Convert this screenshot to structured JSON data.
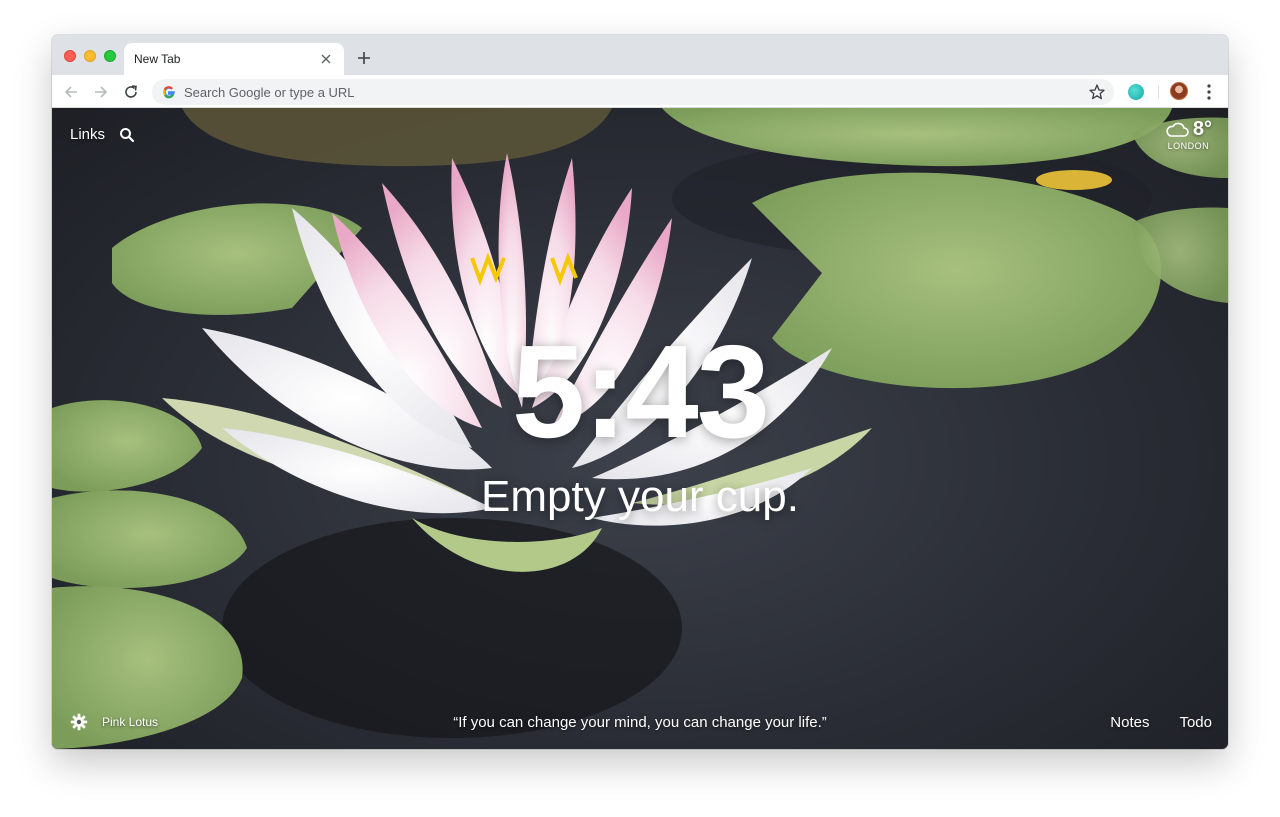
{
  "browser": {
    "tab": {
      "title": "New Tab",
      "close_icon": "close-icon"
    },
    "new_tab_icon": "plus-icon",
    "omnibox": {
      "placeholder": "Search Google or type a URL",
      "icon": "google-icon"
    },
    "toolbar_icons": [
      "back-icon",
      "forward-icon",
      "reload-icon",
      "star-icon",
      "extension-icon",
      "profile-avatar",
      "menu-icon"
    ]
  },
  "dashboard": {
    "links_label": "Links",
    "weather": {
      "temperature": "8°",
      "location": "LONDON",
      "icon": "cloud-icon"
    },
    "clock": "5:43",
    "mantra": "Empty your cup.",
    "photo_credit": "Pink Lotus",
    "quote": "“If you can change your mind, you can change your life.”",
    "notes_label": "Notes",
    "todo_label": "Todo"
  },
  "colors": {
    "accent_text": "#ffffff",
    "tab_strip": "#dee1e6",
    "omnibox_bg": "#f1f3f4",
    "lily_pad": "#8fb06a",
    "lotus_pink": "#f2b8d0"
  }
}
